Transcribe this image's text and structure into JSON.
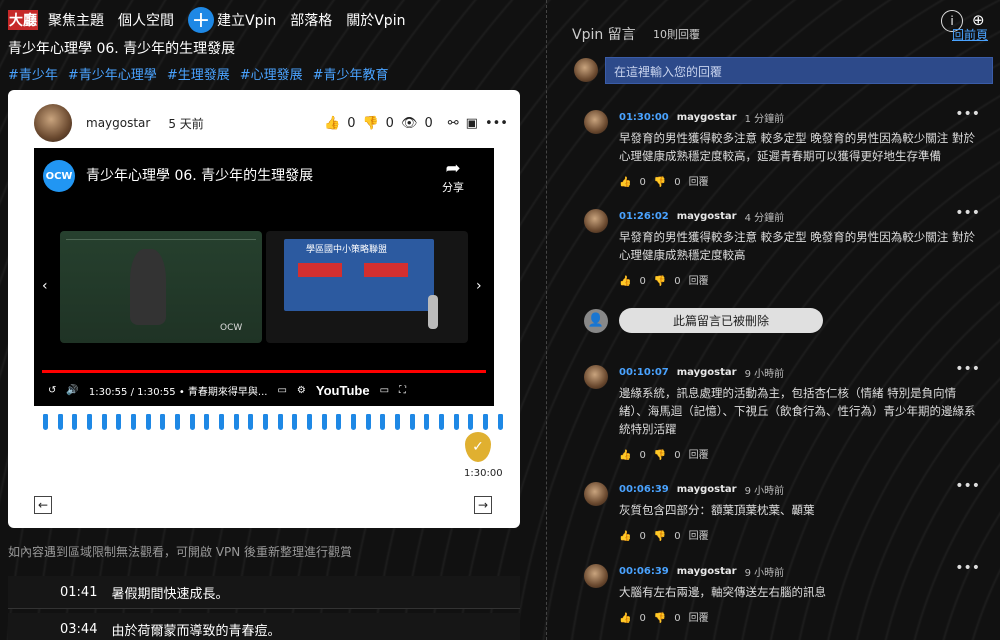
{
  "nav": {
    "logo": "大廳",
    "items": [
      "聚焦主題",
      "個人空間",
      "建立Vpin",
      "部落格",
      "關於Vpin"
    ]
  },
  "video_title": "青少年心理學 06. 青少年的生理發展",
  "tags": [
    "#青少年",
    "#青少年心理學",
    "#生理發展",
    "#心理發展",
    "#青少年教育"
  ],
  "card": {
    "user": "maygostar",
    "time": "5 天前",
    "likes": "0",
    "dislikes": "0",
    "views": "0"
  },
  "player": {
    "logo": "OCW",
    "title": "青少年心理學 06. 青少年的生理發展",
    "share": "分享",
    "time": "1:30:55 / 1:30:55 • 青春期來得早與...",
    "youtube": "YouTube",
    "slide_title": "學區國中小策略聯盟"
  },
  "pin_time": "1:30:00",
  "notice": "如內容遇到區域限制無法觀看，可開啟 VPN 後重新整理進行觀賞",
  "chapters": [
    {
      "time": "01:41",
      "text": "暑假期間快速成長。"
    },
    {
      "time": "03:44",
      "text": "由於荷爾蒙而導致的青春痘。"
    }
  ],
  "sidebar": {
    "title": "Vpin 留言",
    "count": "10則回覆",
    "back": "回前頁",
    "reply_placeholder": "在這裡輸入您的回覆",
    "deleted": "此篇留言已被刪除"
  },
  "comments": [
    {
      "ts": "01:30:00",
      "user": "maygostar",
      "ago": "1 分鐘前",
      "text": "早發育的男性獲得較多注意 較多定型 晚發育的男性因為較少關注 對於心理健康成熟穩定度較高，延遲青春期可以獲得更好地生存準備",
      "likes": "0",
      "dislikes": "0",
      "reply": "回覆"
    },
    {
      "ts": "01:26:02",
      "user": "maygostar",
      "ago": "4 分鐘前",
      "text": "早發育的男性獲得較多注意 較多定型 晚發育的男性因為較少關注 對於心理健康成熟穩定度較高",
      "likes": "0",
      "dislikes": "0",
      "reply": "回覆"
    },
    {
      "ts": "00:10:07",
      "user": "maygostar",
      "ago": "9 小時前",
      "text": "邊緣系統，訊息處理的活動為主，包括杏仁核（情緒 特別是負向情緒）、海馬迴（記憶）、下視丘（飲食行為、性行為）青少年期的邊緣系統特別活躍",
      "likes": "0",
      "dislikes": "0",
      "reply": "回覆"
    },
    {
      "ts": "00:06:39",
      "user": "maygostar",
      "ago": "9 小時前",
      "text": "灰質包含四部分：額葉頂葉枕葉、顳葉",
      "likes": "0",
      "dislikes": "0",
      "reply": "回覆"
    },
    {
      "ts": "00:06:39",
      "user": "maygostar",
      "ago": "9 小時前",
      "text": "大腦有左右兩邊，軸突傳送左右腦的訊息",
      "likes": "0",
      "dislikes": "0",
      "reply": "回覆"
    }
  ]
}
